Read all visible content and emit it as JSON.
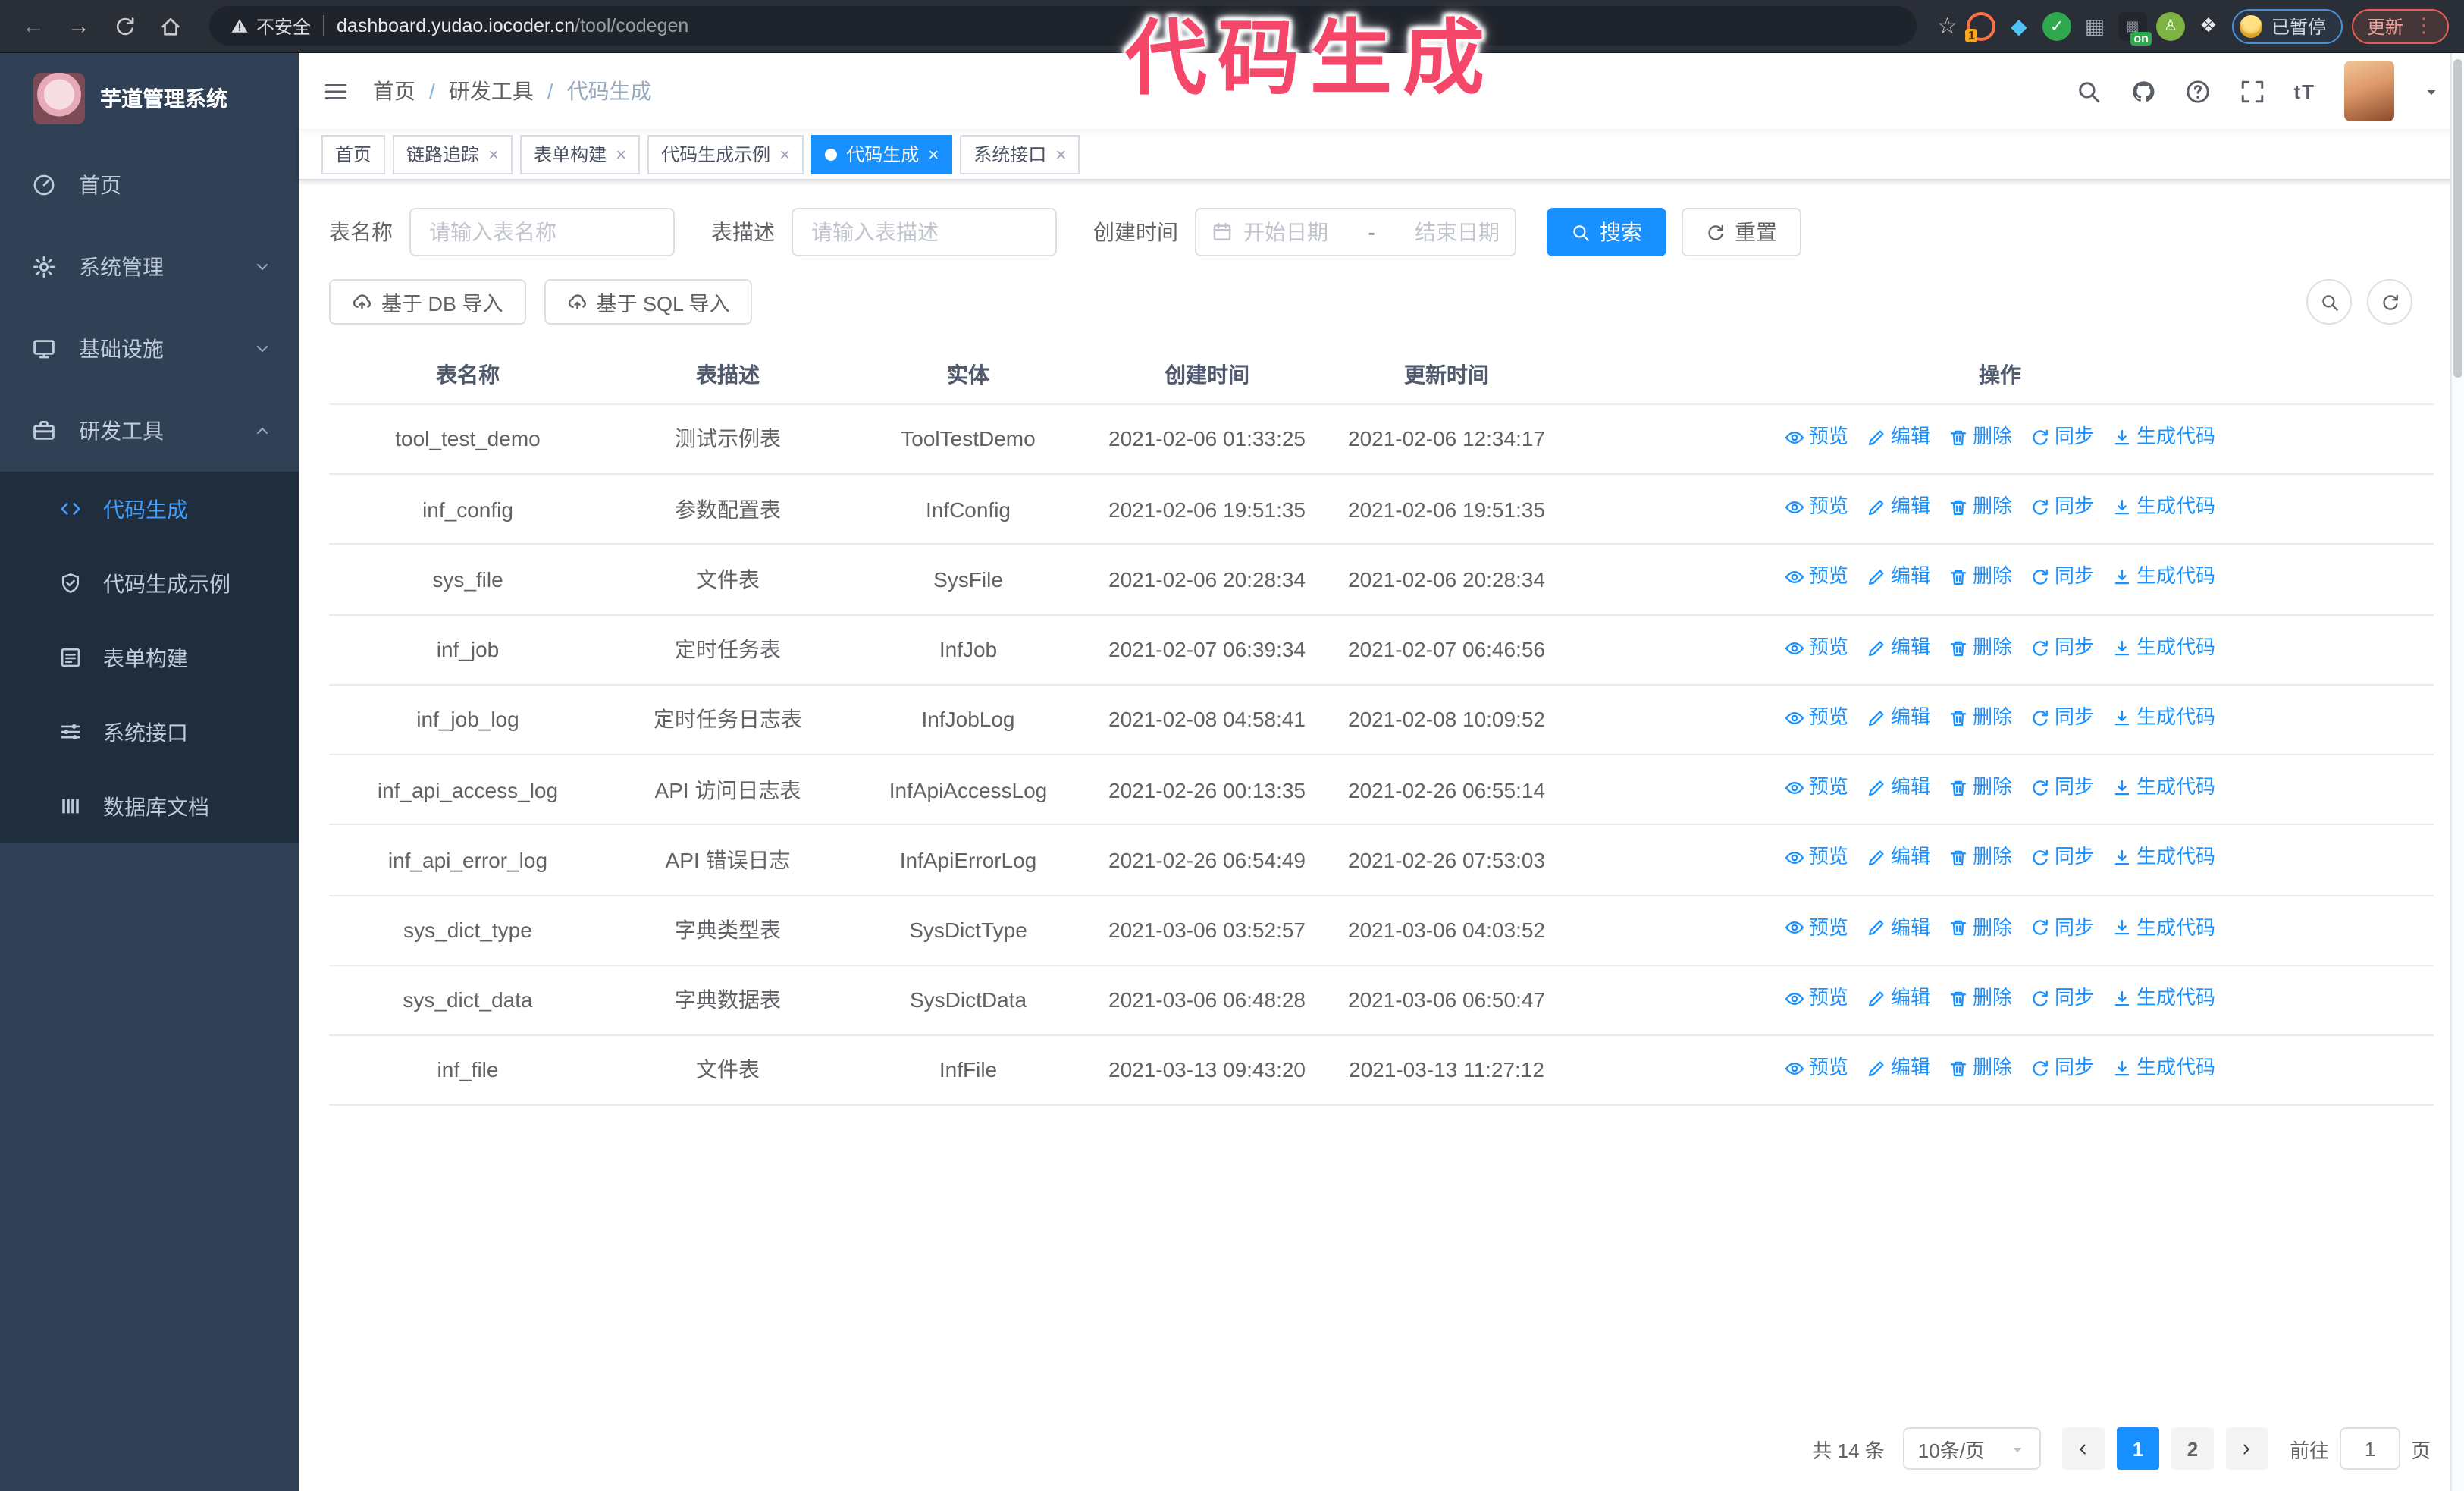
{
  "browser": {
    "warning_label": "不安全",
    "url_host": "dashboard.yudao.iocoder.cn",
    "url_path": "/tool/codegen",
    "paused_label": "已暂停",
    "update_label": "更新"
  },
  "overlay_title": "代码生成",
  "theme": {
    "primary": "#1890ff",
    "sidebar_bg": "#304156",
    "submenu_bg": "#1f2d3d",
    "active_menu_text": "#409eff",
    "overlay_pink": "#f5476a"
  },
  "sidebar": {
    "app_title": "芋道管理系统",
    "items": [
      {
        "name": "home",
        "label": "首页",
        "icon": "dashboard",
        "arrow": ""
      },
      {
        "name": "system-management",
        "label": "系统管理",
        "icon": "gear",
        "arrow": "down"
      },
      {
        "name": "infrastructure",
        "label": "基础设施",
        "icon": "monitor",
        "arrow": "down"
      },
      {
        "name": "dev-tools",
        "label": "研发工具",
        "icon": "briefcase",
        "arrow": "up"
      }
    ],
    "subitems": [
      {
        "name": "codegen",
        "label": "代码生成",
        "icon": "code",
        "active": true
      },
      {
        "name": "codegen-example",
        "label": "代码生成示例",
        "icon": "shield",
        "active": false
      },
      {
        "name": "form-build",
        "label": "表单构建",
        "icon": "form",
        "active": false
      },
      {
        "name": "system-api",
        "label": "系统接口",
        "icon": "sliders",
        "active": false
      },
      {
        "name": "db-doc",
        "label": "数据库文档",
        "icon": "columns",
        "active": false
      }
    ]
  },
  "breadcrumb": {
    "items": [
      "首页",
      "研发工具",
      "代码生成"
    ]
  },
  "tabs": [
    {
      "name": "home",
      "label": "首页",
      "closable": false,
      "active": false
    },
    {
      "name": "trace",
      "label": "链路追踪",
      "closable": true,
      "active": false
    },
    {
      "name": "form-build",
      "label": "表单构建",
      "closable": true,
      "active": false
    },
    {
      "name": "codegen-example",
      "label": "代码生成示例",
      "closable": true,
      "active": false
    },
    {
      "name": "codegen",
      "label": "代码生成",
      "closable": true,
      "active": true
    },
    {
      "name": "system-api",
      "label": "系统接口",
      "closable": true,
      "active": false
    }
  ],
  "filters": {
    "table_name_label": "表名称",
    "table_name_placeholder": "请输入表名称",
    "table_desc_label": "表描述",
    "table_desc_placeholder": "请输入表描述",
    "create_time_label": "创建时间",
    "date_start_placeholder": "开始日期",
    "date_separator": "-",
    "date_end_placeholder": "结束日期",
    "search_label": "搜索",
    "reset_label": "重置"
  },
  "toolbar": {
    "import_db_label": "基于 DB 导入",
    "import_sql_label": "基于 SQL 导入"
  },
  "table": {
    "columns": [
      "表名称",
      "表描述",
      "实体",
      "创建时间",
      "更新时间",
      "操作"
    ],
    "actions": [
      {
        "name": "preview",
        "icon": "eye",
        "label": "预览"
      },
      {
        "name": "edit",
        "icon": "edit",
        "label": "编辑"
      },
      {
        "name": "delete",
        "icon": "trash",
        "label": "删除"
      },
      {
        "name": "sync",
        "icon": "refresh",
        "label": "同步"
      },
      {
        "name": "generate-code",
        "icon": "download",
        "label": "生成代码"
      }
    ],
    "rows": [
      {
        "name": "tool_test_demo",
        "desc": "测试示例表",
        "entity": "ToolTestDemo",
        "created": "2021-02-06 01:33:25",
        "updated": "2021-02-06 12:34:17"
      },
      {
        "name": "inf_config",
        "desc": "参数配置表",
        "entity": "InfConfig",
        "created": "2021-02-06 19:51:35",
        "updated": "2021-02-06 19:51:35"
      },
      {
        "name": "sys_file",
        "desc": "文件表",
        "entity": "SysFile",
        "created": "2021-02-06 20:28:34",
        "updated": "2021-02-06 20:28:34"
      },
      {
        "name": "inf_job",
        "desc": "定时任务表",
        "entity": "InfJob",
        "created": "2021-02-07 06:39:34",
        "updated": "2021-02-07 06:46:56"
      },
      {
        "name": "inf_job_log",
        "desc": "定时任务日志表",
        "entity": "InfJobLog",
        "created": "2021-02-08 04:58:41",
        "updated": "2021-02-08 10:09:52"
      },
      {
        "name": "inf_api_access_log",
        "desc": "API 访问日志表",
        "entity": "InfApiAccessLog",
        "created": "2021-02-26 00:13:35",
        "updated": "2021-02-26 06:55:14"
      },
      {
        "name": "inf_api_error_log",
        "desc": "API 错误日志",
        "entity": "InfApiErrorLog",
        "created": "2021-02-26 06:54:49",
        "updated": "2021-02-26 07:53:03"
      },
      {
        "name": "sys_dict_type",
        "desc": "字典类型表",
        "entity": "SysDictType",
        "created": "2021-03-06 03:52:57",
        "updated": "2021-03-06 04:03:52"
      },
      {
        "name": "sys_dict_data",
        "desc": "字典数据表",
        "entity": "SysDictData",
        "created": "2021-03-06 06:48:28",
        "updated": "2021-03-06 06:50:47"
      },
      {
        "name": "inf_file",
        "desc": "文件表",
        "entity": "InfFile",
        "created": "2021-03-13 09:43:20",
        "updated": "2021-03-13 11:27:12"
      }
    ]
  },
  "pagination": {
    "total_label": "共 14 条",
    "page_size": "10条/页",
    "pages": [
      "1",
      "2"
    ],
    "active_page": "1",
    "goto_label": "前往",
    "goto_value": "1",
    "unit_label": "页"
  }
}
